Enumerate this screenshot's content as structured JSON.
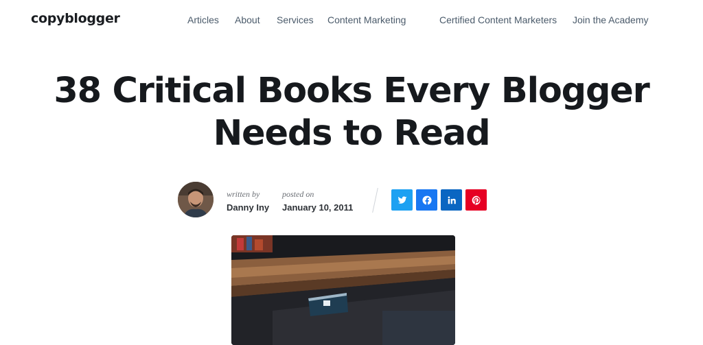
{
  "header": {
    "logo": "copyblogger",
    "nav": [
      "Articles",
      "About",
      "Services",
      "Content Marketing",
      "Certified Content Marketers",
      "Join the Academy"
    ]
  },
  "article": {
    "title_line1": "38 Critical Books Every Blogger",
    "title_line2": "Needs to Read",
    "written_by_label": "written by",
    "author": "Danny Iny",
    "posted_on_label": "posted on",
    "date": "January 10, 2011"
  },
  "share": {
    "buttons": [
      {
        "icon": "twitter-icon",
        "color": "#1da1f2"
      },
      {
        "icon": "facebook-icon",
        "color": "#1877f2"
      },
      {
        "icon": "linkedin-icon",
        "color": "#0a66c2"
      },
      {
        "icon": "pinterest-icon",
        "color": "#e60023"
      }
    ]
  }
}
